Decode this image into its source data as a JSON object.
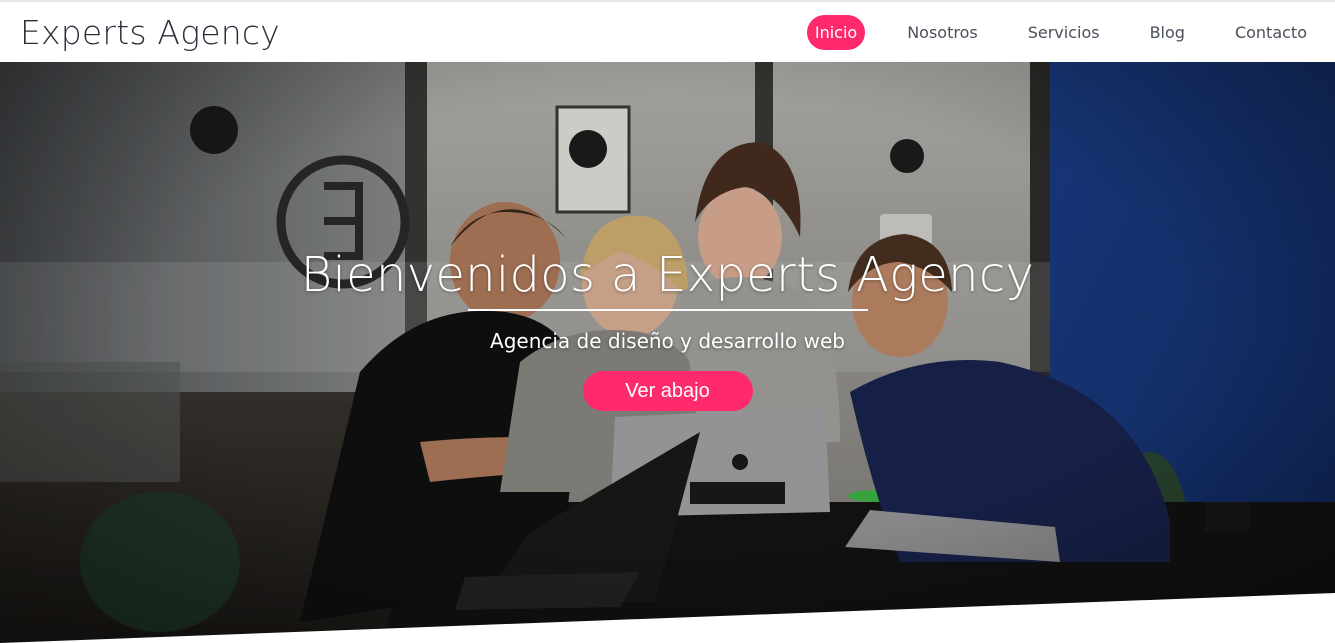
{
  "brand": {
    "name": "Experts Agency"
  },
  "nav": {
    "items": [
      {
        "label": "Inicio",
        "active": true
      },
      {
        "label": "Nosotros",
        "active": false
      },
      {
        "label": "Servicios",
        "active": false
      },
      {
        "label": "Blog",
        "active": false
      },
      {
        "label": "Contacto",
        "active": false
      }
    ]
  },
  "hero": {
    "title": "Bienvenidos a Experts Agency",
    "subtitle": "Agencia de diseño y desarrollo web",
    "cta_label": "Ver abajo"
  },
  "colors": {
    "accent": "#ff2a6b",
    "brand_text": "#2a2f3a",
    "nav_text": "#4a4f59",
    "wall_blue": "#1c3f8a"
  }
}
